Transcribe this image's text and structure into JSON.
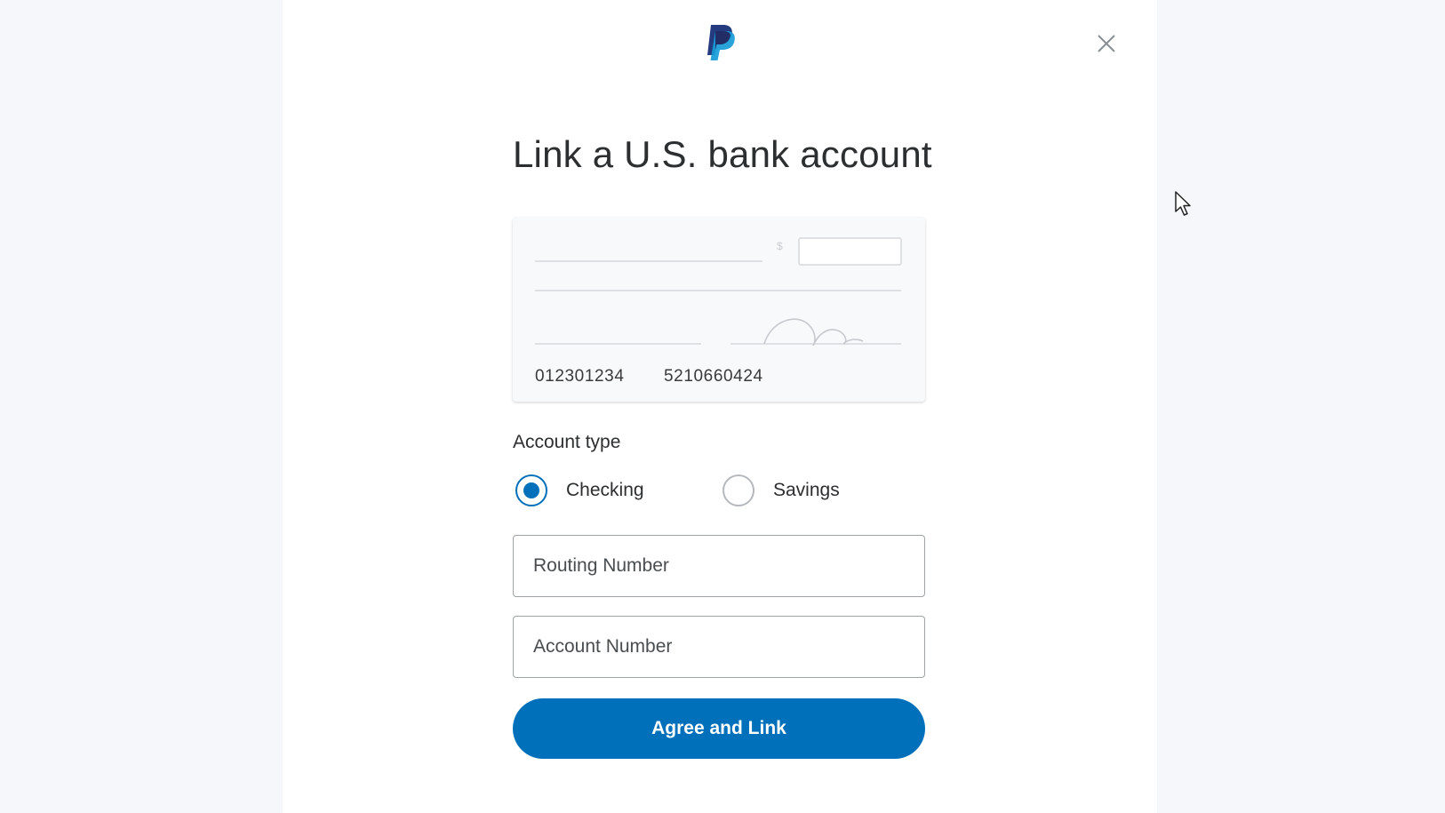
{
  "brand": {
    "logo_icon": "paypal-logo-icon",
    "primary_color": "#0070ba",
    "secondary_color": "#253b80",
    "tertiary_color": "#179bd7"
  },
  "dialog": {
    "close_icon": "close-icon",
    "title": "Link a U.S. bank account"
  },
  "cheque": {
    "illustration_icon": "bank-cheque-illustration",
    "routing_number": "012301234",
    "account_number": "5210660424"
  },
  "account_type": {
    "label": "Account type",
    "options": [
      {
        "label": "Checking",
        "selected": true
      },
      {
        "label": "Savings",
        "selected": false
      }
    ]
  },
  "form": {
    "routing_placeholder": "Routing Number",
    "routing_value": "",
    "account_placeholder": "Account Number",
    "account_value": ""
  },
  "actions": {
    "submit_label": "Agree and Link"
  }
}
